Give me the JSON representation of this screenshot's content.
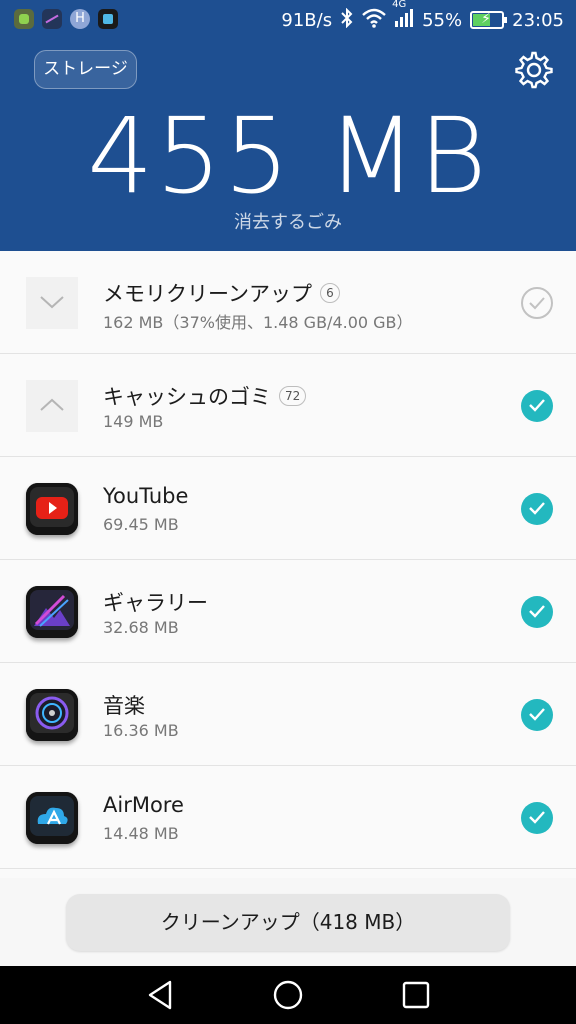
{
  "status_bar": {
    "notification_icons": [
      "android-app-icon",
      "gallery-app-icon",
      "h-app-icon",
      "media-app-icon"
    ],
    "h_letter": "H",
    "net_speed": "91B/s",
    "network_type": "4G",
    "battery_percent": "55%",
    "time": "23:05"
  },
  "header": {
    "storage_chip_label": "ストレージ",
    "junk_amount": "455 MB",
    "junk_label": "消去するごみ",
    "bg_color": "#1e4f91"
  },
  "rows": [
    {
      "title": "メモリクリーンアップ",
      "count": "6",
      "subtitle": "162 MB（37%使用、1.48 GB/4.00 GB）",
      "checked": false,
      "lead": "chevron-down"
    },
    {
      "title": "キャッシュのゴミ",
      "count": "72",
      "subtitle": "149 MB",
      "checked": true,
      "lead": "chevron-up"
    },
    {
      "title": "YouTube",
      "subtitle": "69.45 MB",
      "checked": true,
      "lead": "youtube-icon"
    },
    {
      "title": "ギャラリー",
      "subtitle": "32.68 MB",
      "checked": true,
      "lead": "gallery-icon"
    },
    {
      "title": "音楽",
      "subtitle": "16.36 MB",
      "checked": true,
      "lead": "music-icon"
    },
    {
      "title": "AirMore",
      "subtitle": "14.48 MB",
      "checked": true,
      "lead": "airmore-icon"
    }
  ],
  "action": {
    "clean_button": "クリーンアップ（418 MB）"
  },
  "nav_bar": {
    "buttons": [
      "back-icon",
      "home-icon",
      "recents-icon"
    ]
  },
  "colors": {
    "accent_check": "#23b8bf",
    "header": "#1e4f91"
  }
}
